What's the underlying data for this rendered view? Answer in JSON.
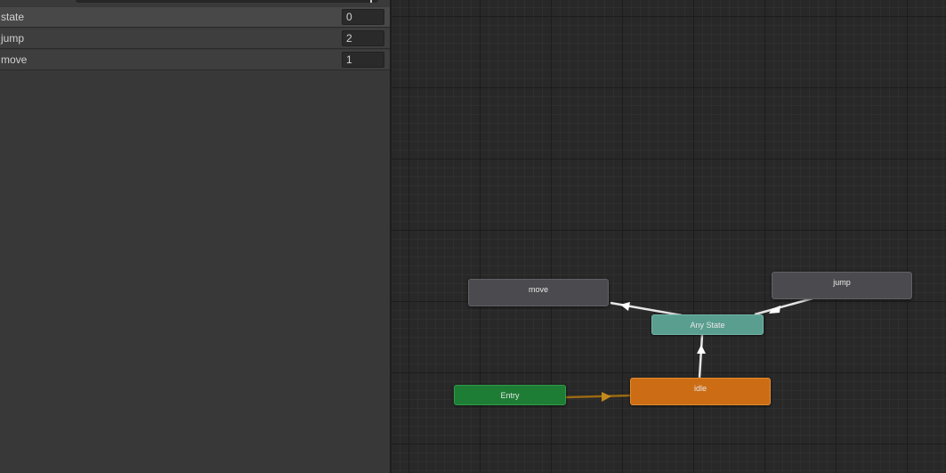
{
  "parameters": [
    {
      "name": "state",
      "value": "0"
    },
    {
      "name": "jump",
      "value": "2"
    },
    {
      "name": "move",
      "value": "1"
    }
  ],
  "graph": {
    "nodes": {
      "move": "move",
      "jump": "jump",
      "any_state": "Any State",
      "entry": "Entry",
      "idle": "idle"
    },
    "colors": {
      "default_state": "#4b4b4f",
      "any_state": "#5a9e90",
      "entry": "#1e7d35",
      "default_layer_state": "#cc6d16",
      "transition": "#e6e6e6",
      "entry_transition": "#9a6a12"
    }
  }
}
